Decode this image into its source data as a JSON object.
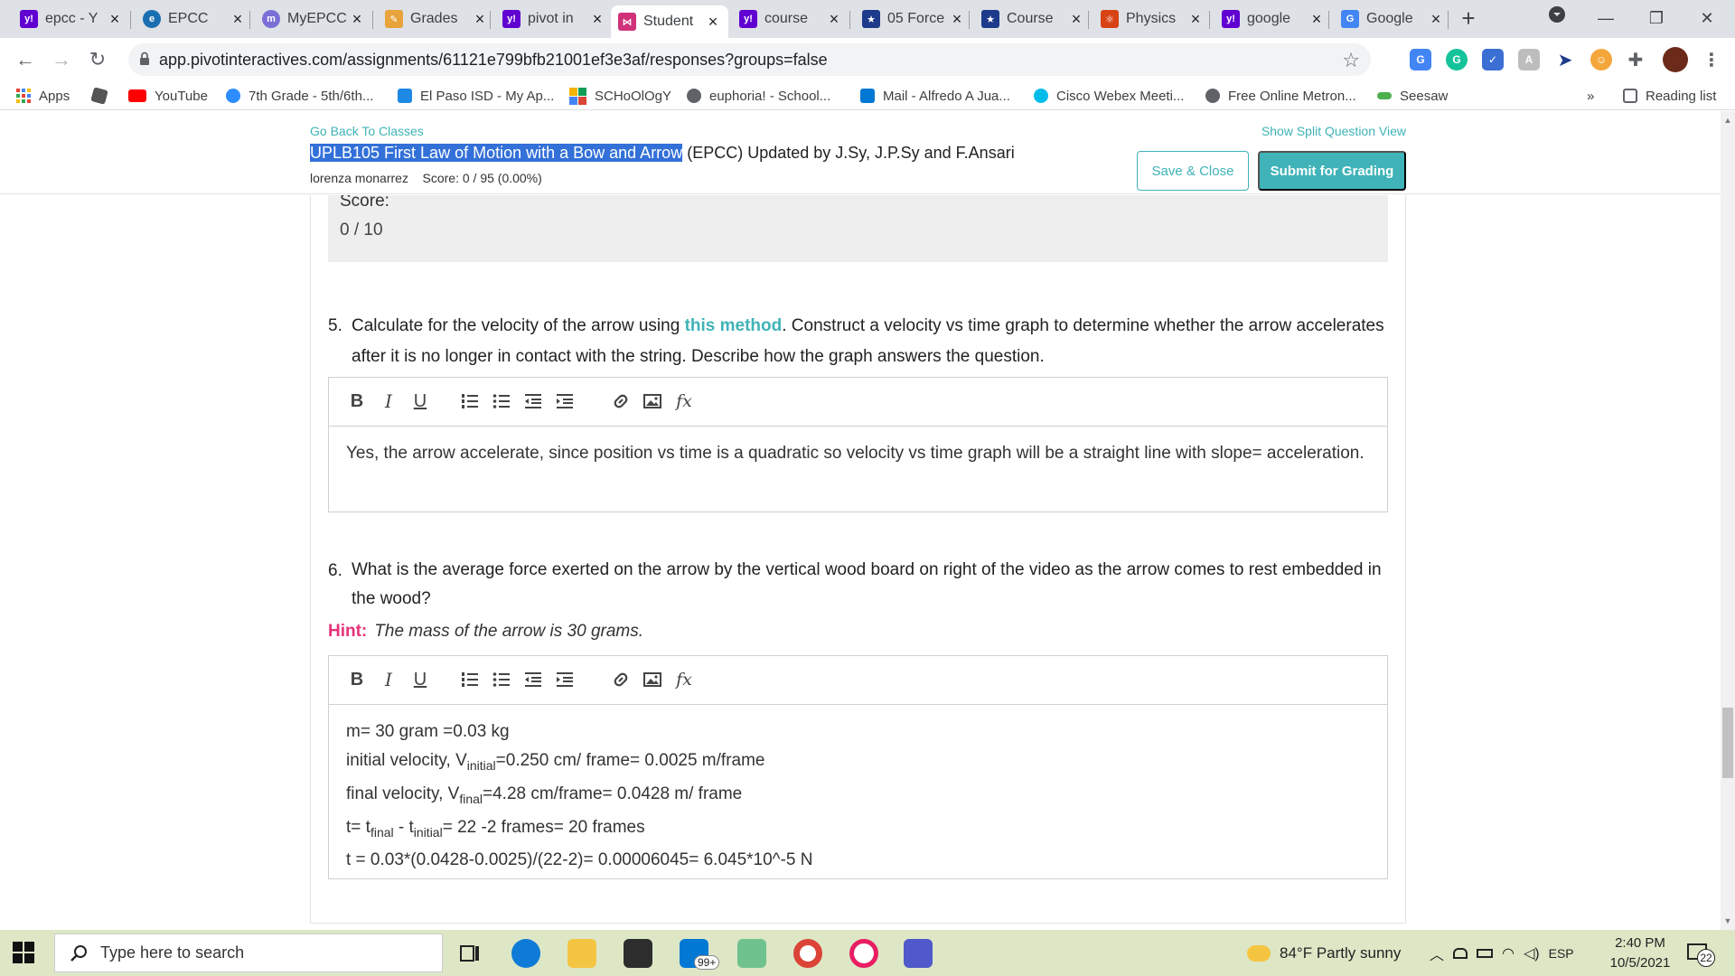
{
  "browser": {
    "tabs": [
      {
        "label": "epcc - Y",
        "icon": "yahoo-icon",
        "color": "#6001d2"
      },
      {
        "label": "EPCC",
        "icon": "epcc-icon",
        "color": "#1a6fb0"
      },
      {
        "label": "MyEPCC",
        "icon": "myepcc-icon",
        "color": "#7a6fd6"
      },
      {
        "label": "Grades",
        "icon": "grades-icon",
        "color": "#e8a33a"
      },
      {
        "label": "pivot in",
        "icon": "yahoo-icon",
        "color": "#6001d2"
      },
      {
        "label": "Student",
        "icon": "pivot-icon",
        "color": "#d0327a"
      },
      {
        "label": "course",
        "icon": "yahoo-icon",
        "color": "#6001d2"
      },
      {
        "label": "05 Force",
        "icon": "star-icon",
        "color": "#1e3a8a"
      },
      {
        "label": "Course",
        "icon": "star-icon",
        "color": "#1e3a8a"
      },
      {
        "label": "Physics",
        "icon": "physics-icon",
        "color": "#d84315"
      },
      {
        "label": "google",
        "icon": "yahoo-icon",
        "color": "#6001d2"
      },
      {
        "label": "Google",
        "icon": "google-translate-icon",
        "color": "#4285f4"
      }
    ],
    "new_tab": "+",
    "url": "app.pivotinteractives.com/assignments/61121e799bfb21001ef3e3af/responses?groups=false",
    "bookmarks": [
      {
        "label": "Apps",
        "color": "#4285f4"
      },
      {
        "label": "",
        "color": "#555555"
      },
      {
        "label": "YouTube",
        "color": "#ff0000"
      },
      {
        "label": "7th Grade - 5th/6th...",
        "color": "#2d8cff"
      },
      {
        "label": "El Paso ISD - My Ap...",
        "color": "#1e88e5"
      },
      {
        "label": "SCHoOlOgY",
        "color": "#f4b400"
      },
      {
        "label": "euphoria! - School...",
        "color": "#5f6368"
      },
      {
        "label": "Mail - Alfredo A Jua...",
        "color": "#0078d4"
      },
      {
        "label": "Cisco Webex Meeti...",
        "color": "#00bceb"
      },
      {
        "label": "Free Online Metron...",
        "color": "#5f6368"
      },
      {
        "label": "Seesaw",
        "color": "#4caf50"
      }
    ],
    "more_bookmarks": "»",
    "reading_list": "Reading list"
  },
  "header": {
    "go_back": "Go Back To Classes",
    "split_view": "Show Split Question View",
    "title_highlight": "UPLB105 First Law of Motion with a Bow and Arrow",
    "title_rest": " (EPCC) Updated by J.Sy, J.P.Sy and F.Ansari",
    "student_name": "lorenza monarrez",
    "score_label": "Score:",
    "score_value": "0 / 95 (0.00%)",
    "save_label": "Save & Close",
    "submit_label": "Submit for Grading"
  },
  "score_block": {
    "label": "Score:",
    "value": "0 / 10"
  },
  "q5": {
    "number": "5.",
    "text_before": "Calculate for the velocity of the arrow using ",
    "link": "this method",
    "text_after": ". Construct a velocity vs time graph to determine whether the arrow accelerates after it is no longer in contact with the string. Describe how the graph answers the question.",
    "answer": "Yes, the arrow accelerate, since position vs time is a quadratic so velocity vs time graph will be a straight line with slope= acceleration."
  },
  "q6": {
    "number": "6.",
    "text": "What is the average force exerted on the arrow by the vertical wood board on right of the video as the arrow comes to rest embedded in the wood?",
    "hint_label": "Hint:",
    "hint_text": "The mass of the arrow is 30 grams.",
    "answer": {
      "l1": "m= 30 gram =0.03 kg",
      "l2_pre": "initial velocity, V",
      "l2_sub": "initial",
      "l2_post": "=0.250 cm/ frame= 0.0025 m/frame",
      "l3_pre": "final velocity, V",
      "l3_sub": "final",
      "l3_post": "=4.28 cm/frame= 0.0428 m/ frame",
      "l4_a": "t= t",
      "l4_sub1": "final",
      "l4_b": " - t",
      "l4_sub2": "initial",
      "l4_c": "= 22 -2 frames= 20 frames",
      "l5": "t = 0.03*(0.0428-0.0025)/(22-2)= 0.00006045= 6.045*10^-5 N"
    }
  },
  "editor_tools": {
    "bold": "B",
    "italic": "I",
    "underline": "U",
    "formula": "fx"
  },
  "taskbar": {
    "search_placeholder": "Type here to search",
    "mail_badge": "99+",
    "weather": "84°F  Partly sunny",
    "language": "ESP",
    "time": "2:40 PM",
    "date": "10/5/2021",
    "notifications": "22"
  },
  "colors": {
    "accent": "#3fb3b8",
    "hint": "#e6337a",
    "selection": "#3370d8"
  }
}
